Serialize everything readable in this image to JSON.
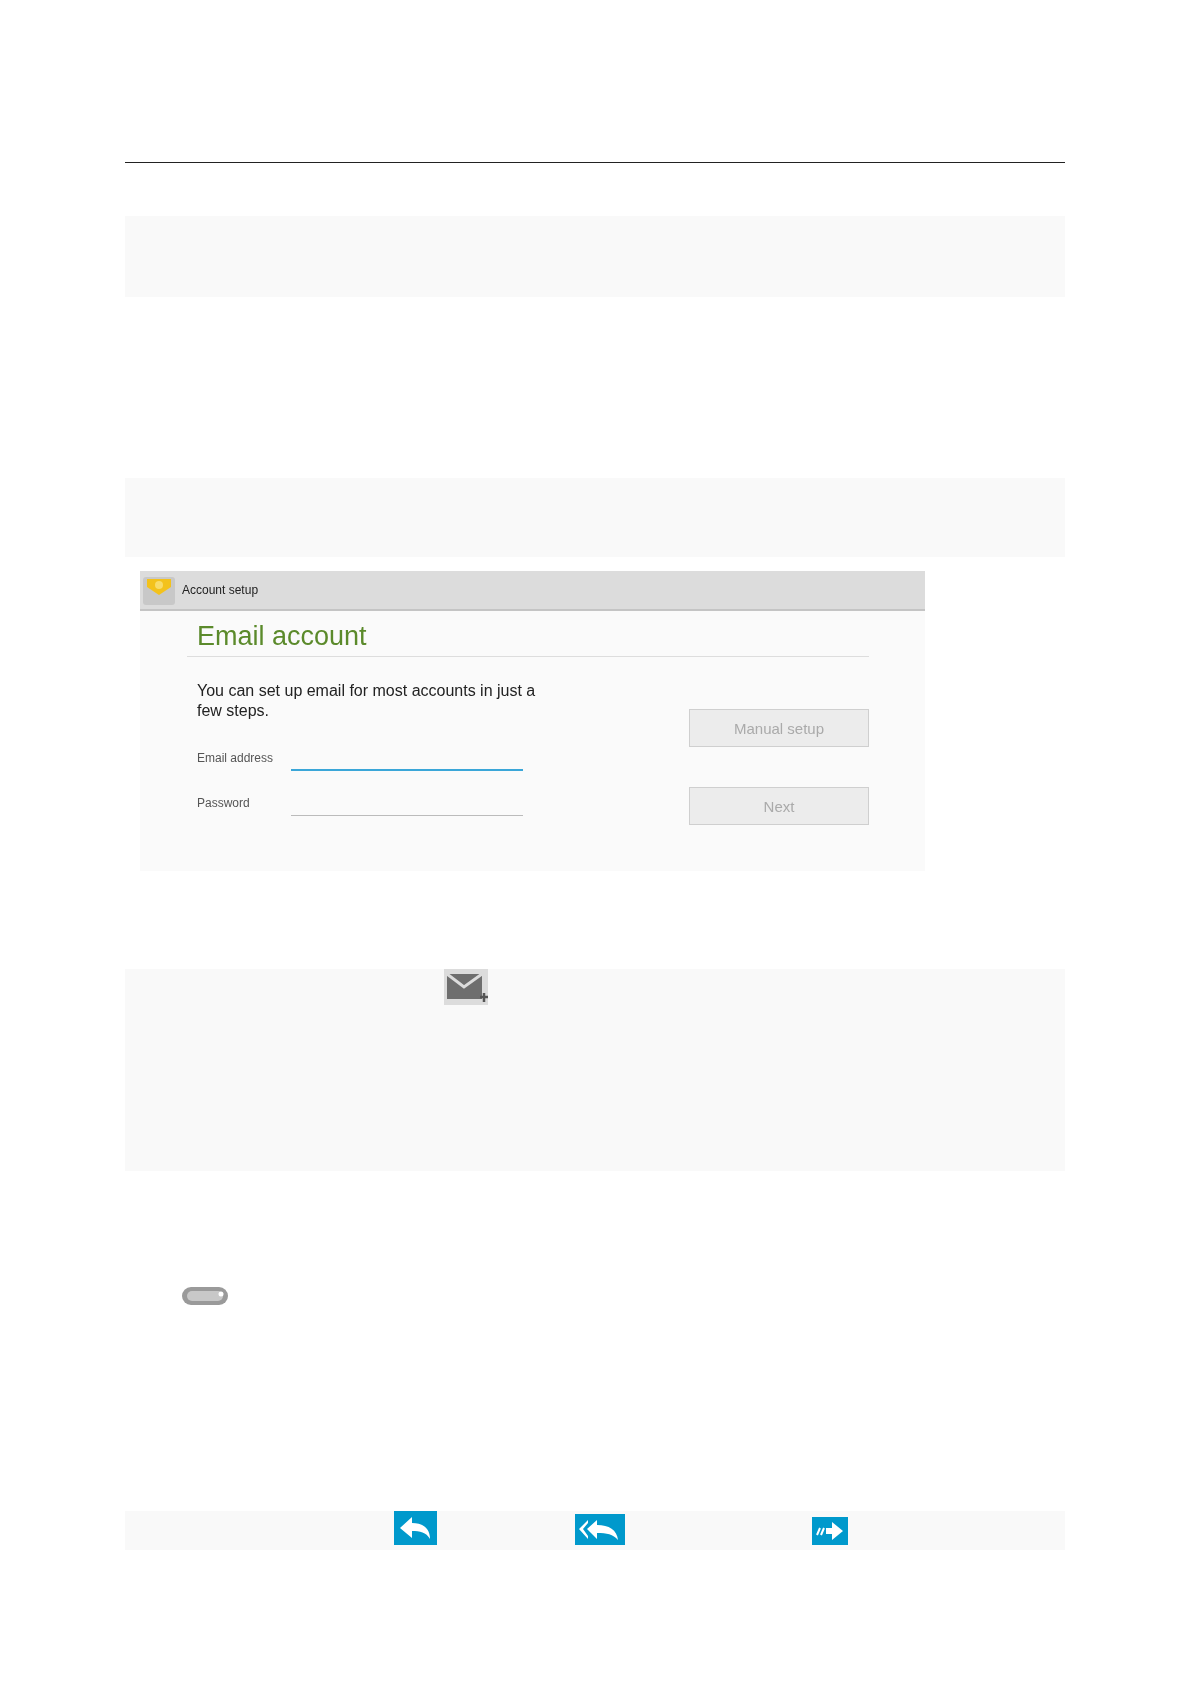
{
  "screenshot": {
    "title": "Account setup",
    "heading": "Email account",
    "intro": "You can set up email for most accounts in just a few steps.",
    "fields": [
      {
        "label": "Email address",
        "focused": true
      },
      {
        "label": "Password",
        "focused": false
      }
    ],
    "buttons": [
      {
        "label": "Manual setup",
        "disabled": true
      },
      {
        "label": "Next",
        "disabled": true
      }
    ]
  }
}
